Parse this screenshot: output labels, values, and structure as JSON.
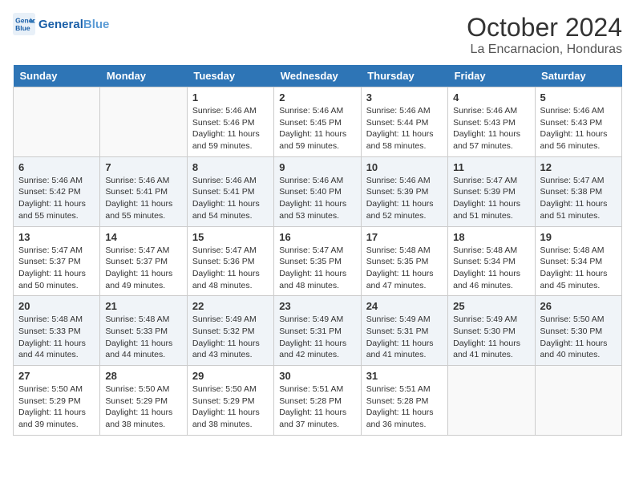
{
  "header": {
    "logo_line1": "General",
    "logo_line2": "Blue",
    "month": "October 2024",
    "location": "La Encarnacion, Honduras"
  },
  "weekdays": [
    "Sunday",
    "Monday",
    "Tuesday",
    "Wednesday",
    "Thursday",
    "Friday",
    "Saturday"
  ],
  "weeks": [
    [
      {
        "day": "",
        "sunrise": "",
        "sunset": "",
        "daylight": ""
      },
      {
        "day": "",
        "sunrise": "",
        "sunset": "",
        "daylight": ""
      },
      {
        "day": "1",
        "sunrise": "Sunrise: 5:46 AM",
        "sunset": "Sunset: 5:46 PM",
        "daylight": "Daylight: 11 hours and 59 minutes."
      },
      {
        "day": "2",
        "sunrise": "Sunrise: 5:46 AM",
        "sunset": "Sunset: 5:45 PM",
        "daylight": "Daylight: 11 hours and 59 minutes."
      },
      {
        "day": "3",
        "sunrise": "Sunrise: 5:46 AM",
        "sunset": "Sunset: 5:44 PM",
        "daylight": "Daylight: 11 hours and 58 minutes."
      },
      {
        "day": "4",
        "sunrise": "Sunrise: 5:46 AM",
        "sunset": "Sunset: 5:43 PM",
        "daylight": "Daylight: 11 hours and 57 minutes."
      },
      {
        "day": "5",
        "sunrise": "Sunrise: 5:46 AM",
        "sunset": "Sunset: 5:43 PM",
        "daylight": "Daylight: 11 hours and 56 minutes."
      }
    ],
    [
      {
        "day": "6",
        "sunrise": "Sunrise: 5:46 AM",
        "sunset": "Sunset: 5:42 PM",
        "daylight": "Daylight: 11 hours and 55 minutes."
      },
      {
        "day": "7",
        "sunrise": "Sunrise: 5:46 AM",
        "sunset": "Sunset: 5:41 PM",
        "daylight": "Daylight: 11 hours and 55 minutes."
      },
      {
        "day": "8",
        "sunrise": "Sunrise: 5:46 AM",
        "sunset": "Sunset: 5:41 PM",
        "daylight": "Daylight: 11 hours and 54 minutes."
      },
      {
        "day": "9",
        "sunrise": "Sunrise: 5:46 AM",
        "sunset": "Sunset: 5:40 PM",
        "daylight": "Daylight: 11 hours and 53 minutes."
      },
      {
        "day": "10",
        "sunrise": "Sunrise: 5:46 AM",
        "sunset": "Sunset: 5:39 PM",
        "daylight": "Daylight: 11 hours and 52 minutes."
      },
      {
        "day": "11",
        "sunrise": "Sunrise: 5:47 AM",
        "sunset": "Sunset: 5:39 PM",
        "daylight": "Daylight: 11 hours and 51 minutes."
      },
      {
        "day": "12",
        "sunrise": "Sunrise: 5:47 AM",
        "sunset": "Sunset: 5:38 PM",
        "daylight": "Daylight: 11 hours and 51 minutes."
      }
    ],
    [
      {
        "day": "13",
        "sunrise": "Sunrise: 5:47 AM",
        "sunset": "Sunset: 5:37 PM",
        "daylight": "Daylight: 11 hours and 50 minutes."
      },
      {
        "day": "14",
        "sunrise": "Sunrise: 5:47 AM",
        "sunset": "Sunset: 5:37 PM",
        "daylight": "Daylight: 11 hours and 49 minutes."
      },
      {
        "day": "15",
        "sunrise": "Sunrise: 5:47 AM",
        "sunset": "Sunset: 5:36 PM",
        "daylight": "Daylight: 11 hours and 48 minutes."
      },
      {
        "day": "16",
        "sunrise": "Sunrise: 5:47 AM",
        "sunset": "Sunset: 5:35 PM",
        "daylight": "Daylight: 11 hours and 48 minutes."
      },
      {
        "day": "17",
        "sunrise": "Sunrise: 5:48 AM",
        "sunset": "Sunset: 5:35 PM",
        "daylight": "Daylight: 11 hours and 47 minutes."
      },
      {
        "day": "18",
        "sunrise": "Sunrise: 5:48 AM",
        "sunset": "Sunset: 5:34 PM",
        "daylight": "Daylight: 11 hours and 46 minutes."
      },
      {
        "day": "19",
        "sunrise": "Sunrise: 5:48 AM",
        "sunset": "Sunset: 5:34 PM",
        "daylight": "Daylight: 11 hours and 45 minutes."
      }
    ],
    [
      {
        "day": "20",
        "sunrise": "Sunrise: 5:48 AM",
        "sunset": "Sunset: 5:33 PM",
        "daylight": "Daylight: 11 hours and 44 minutes."
      },
      {
        "day": "21",
        "sunrise": "Sunrise: 5:48 AM",
        "sunset": "Sunset: 5:33 PM",
        "daylight": "Daylight: 11 hours and 44 minutes."
      },
      {
        "day": "22",
        "sunrise": "Sunrise: 5:49 AM",
        "sunset": "Sunset: 5:32 PM",
        "daylight": "Daylight: 11 hours and 43 minutes."
      },
      {
        "day": "23",
        "sunrise": "Sunrise: 5:49 AM",
        "sunset": "Sunset: 5:31 PM",
        "daylight": "Daylight: 11 hours and 42 minutes."
      },
      {
        "day": "24",
        "sunrise": "Sunrise: 5:49 AM",
        "sunset": "Sunset: 5:31 PM",
        "daylight": "Daylight: 11 hours and 41 minutes."
      },
      {
        "day": "25",
        "sunrise": "Sunrise: 5:49 AM",
        "sunset": "Sunset: 5:30 PM",
        "daylight": "Daylight: 11 hours and 41 minutes."
      },
      {
        "day": "26",
        "sunrise": "Sunrise: 5:50 AM",
        "sunset": "Sunset: 5:30 PM",
        "daylight": "Daylight: 11 hours and 40 minutes."
      }
    ],
    [
      {
        "day": "27",
        "sunrise": "Sunrise: 5:50 AM",
        "sunset": "Sunset: 5:29 PM",
        "daylight": "Daylight: 11 hours and 39 minutes."
      },
      {
        "day": "28",
        "sunrise": "Sunrise: 5:50 AM",
        "sunset": "Sunset: 5:29 PM",
        "daylight": "Daylight: 11 hours and 38 minutes."
      },
      {
        "day": "29",
        "sunrise": "Sunrise: 5:50 AM",
        "sunset": "Sunset: 5:29 PM",
        "daylight": "Daylight: 11 hours and 38 minutes."
      },
      {
        "day": "30",
        "sunrise": "Sunrise: 5:51 AM",
        "sunset": "Sunset: 5:28 PM",
        "daylight": "Daylight: 11 hours and 37 minutes."
      },
      {
        "day": "31",
        "sunrise": "Sunrise: 5:51 AM",
        "sunset": "Sunset: 5:28 PM",
        "daylight": "Daylight: 11 hours and 36 minutes."
      },
      {
        "day": "",
        "sunrise": "",
        "sunset": "",
        "daylight": ""
      },
      {
        "day": "",
        "sunrise": "",
        "sunset": "",
        "daylight": ""
      }
    ]
  ]
}
